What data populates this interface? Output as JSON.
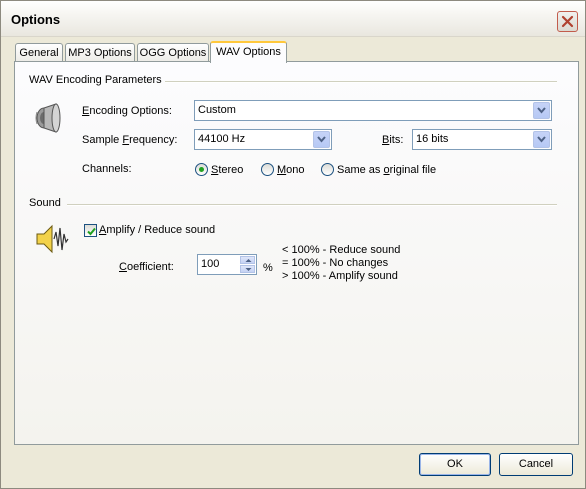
{
  "window": {
    "title": "Options",
    "close_label": "×"
  },
  "tabs": [
    {
      "label": "General",
      "active": false
    },
    {
      "label": "MP3 Options",
      "active": false
    },
    {
      "label": "OGG Options",
      "active": false
    },
    {
      "label": "WAV Options",
      "active": true
    }
  ],
  "wav_group": {
    "title": "WAV Encoding Parameters",
    "icon": "speaker-icon",
    "encoding_options": {
      "label_pre": "",
      "label_key": "E",
      "label_post": "ncoding Options:",
      "value": "Custom"
    },
    "sample_frequency": {
      "label_pre": "Sample ",
      "label_key": "F",
      "label_post": "requency:",
      "value": "44100 Hz"
    },
    "bits": {
      "label_pre": "",
      "label_key": "B",
      "label_post": "its:",
      "value": "16 bits"
    },
    "channels": {
      "label": "Channels:",
      "options": [
        {
          "label_pre": "",
          "label_key": "S",
          "label_post": "tereo",
          "checked": true
        },
        {
          "label_pre": "",
          "label_key": "M",
          "label_post": "ono",
          "checked": false
        },
        {
          "label_pre": "Same as ",
          "label_key": "o",
          "label_post": "riginal file",
          "checked": false
        }
      ]
    }
  },
  "sound_group": {
    "title": "Sound",
    "icon": "sound-wave-icon",
    "amplify": {
      "label_pre": "",
      "label_key": "A",
      "label_post": "mplify / Reduce sound",
      "checked": true
    },
    "coefficient": {
      "label_pre": "",
      "label_key": "C",
      "label_post": "oefficient:",
      "value": "100",
      "unit": "%"
    },
    "help": [
      "< 100% - Reduce sound",
      "= 100% - No changes",
      "> 100% - Amplify sound"
    ]
  },
  "buttons": {
    "ok": "OK",
    "cancel": "Cancel"
  },
  "colors": {
    "dialog_bg": "#ece9d8",
    "panel_bg": "#fcfcfe",
    "active_tab_accent": "#ffc83c",
    "input_border": "#7f9db9",
    "radio_dot": "#21a121",
    "close_button_border": "#c25c4c"
  }
}
